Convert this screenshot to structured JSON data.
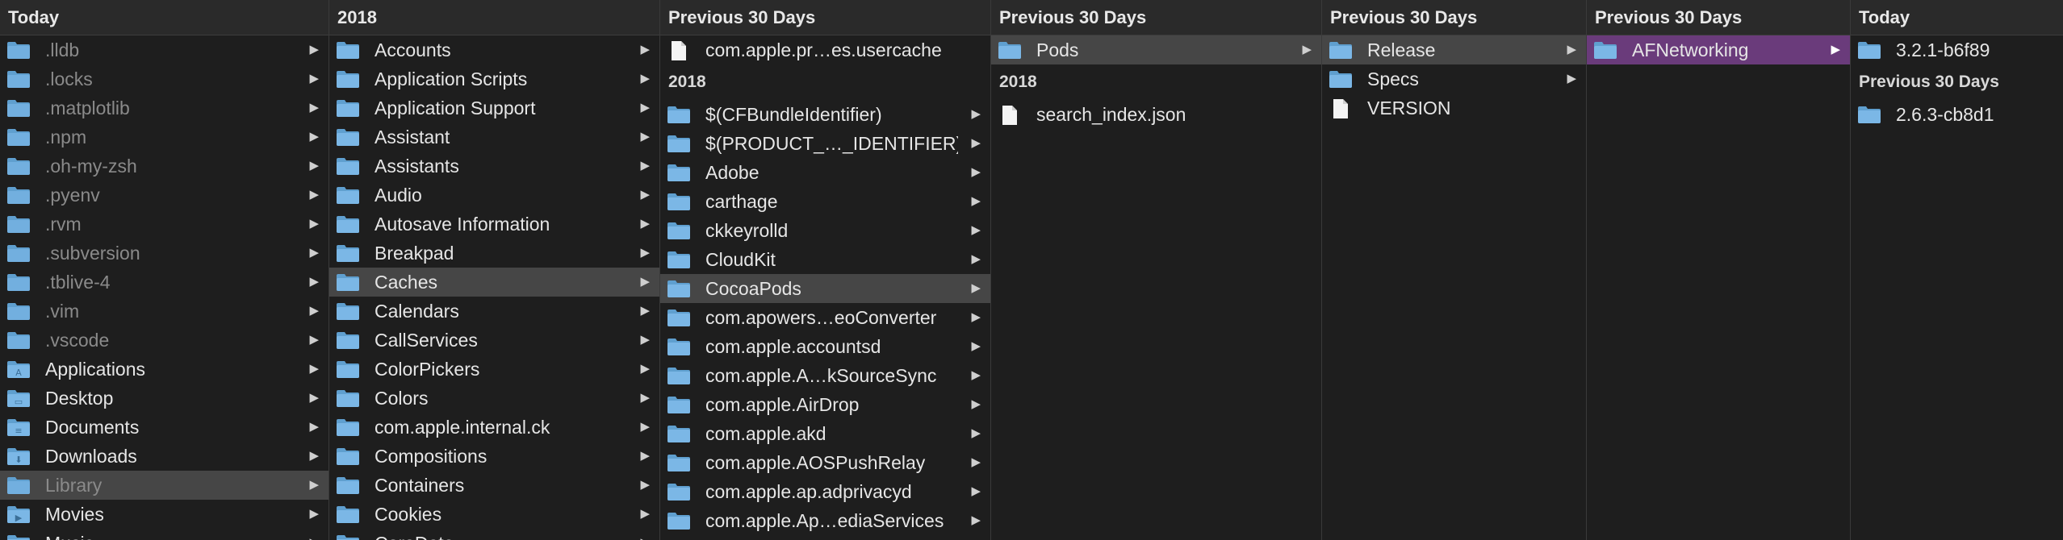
{
  "colors": {
    "background": "#1e1e1e",
    "folder_blue": "#6aaedf",
    "selection_gray": "#464646",
    "selection_purple": "#6a3b7b"
  },
  "columns": [
    {
      "blocks": [
        {
          "header": "Today",
          "items": [
            {
              "label": ".lldb",
              "icon": "folder-icon",
              "dim": true
            },
            {
              "label": ".locks",
              "icon": "folder-icon",
              "dim": true
            },
            {
              "label": ".matplotlib",
              "icon": "folder-icon",
              "dim": true
            },
            {
              "label": ".npm",
              "icon": "folder-icon",
              "dim": true
            },
            {
              "label": ".oh-my-zsh",
              "icon": "folder-icon",
              "dim": true
            },
            {
              "label": ".pyenv",
              "icon": "folder-icon",
              "dim": true
            },
            {
              "label": ".rvm",
              "icon": "folder-icon",
              "dim": true
            },
            {
              "label": ".subversion",
              "icon": "folder-icon",
              "dim": true
            },
            {
              "label": ".tblive-4",
              "icon": "folder-icon",
              "dim": true
            },
            {
              "label": ".vim",
              "icon": "folder-icon",
              "dim": true
            },
            {
              "label": ".vscode",
              "icon": "folder-icon",
              "dim": true
            },
            {
              "label": "Applications",
              "icon": "applications-folder-icon"
            },
            {
              "label": "Desktop",
              "icon": "desktop-folder-icon"
            },
            {
              "label": "Documents",
              "icon": "documents-folder-icon"
            },
            {
              "label": "Downloads",
              "icon": "downloads-folder-icon"
            },
            {
              "label": "Library",
              "icon": "folder-icon",
              "dim": true,
              "selected": "gray"
            },
            {
              "label": "Movies",
              "icon": "movies-folder-icon"
            },
            {
              "label": "Music",
              "icon": "music-folder-icon"
            }
          ]
        }
      ]
    },
    {
      "blocks": [
        {
          "header": "2018",
          "items": [
            {
              "label": "Accounts",
              "icon": "folder-icon"
            },
            {
              "label": "Application Scripts",
              "icon": "folder-icon"
            },
            {
              "label": "Application Support",
              "icon": "folder-icon"
            },
            {
              "label": "Assistant",
              "icon": "folder-icon"
            },
            {
              "label": "Assistants",
              "icon": "folder-icon"
            },
            {
              "label": "Audio",
              "icon": "folder-icon"
            },
            {
              "label": "Autosave Information",
              "icon": "folder-icon"
            },
            {
              "label": "Breakpad",
              "icon": "folder-icon"
            },
            {
              "label": "Caches",
              "icon": "folder-icon",
              "selected": "gray"
            },
            {
              "label": "Calendars",
              "icon": "folder-icon"
            },
            {
              "label": "CallServices",
              "icon": "folder-icon"
            },
            {
              "label": "ColorPickers",
              "icon": "folder-icon"
            },
            {
              "label": "Colors",
              "icon": "folder-icon"
            },
            {
              "label": "com.apple.internal.ck",
              "icon": "folder-icon"
            },
            {
              "label": "Compositions",
              "icon": "folder-icon"
            },
            {
              "label": "Containers",
              "icon": "folder-icon"
            },
            {
              "label": "Cookies",
              "icon": "folder-icon"
            },
            {
              "label": "CoreData",
              "icon": "folder-icon"
            }
          ]
        }
      ]
    },
    {
      "blocks": [
        {
          "header": "Previous 30 Days",
          "items": [
            {
              "label": "com.apple.pr…es.usercache",
              "icon": "file-icon",
              "nochev": true
            }
          ]
        },
        {
          "section": "2018",
          "items": [
            {
              "label": "$(CFBundleIdentifier)",
              "icon": "folder-icon"
            },
            {
              "label": "$(PRODUCT_…_IDENTIFIER)",
              "icon": "folder-icon"
            },
            {
              "label": "Adobe",
              "icon": "folder-icon"
            },
            {
              "label": "carthage",
              "icon": "folder-icon"
            },
            {
              "label": "ckkeyrolld",
              "icon": "folder-icon"
            },
            {
              "label": "CloudKit",
              "icon": "folder-icon"
            },
            {
              "label": "CocoaPods",
              "icon": "folder-icon",
              "selected": "gray"
            },
            {
              "label": "com.apowers…eoConverter",
              "icon": "folder-icon"
            },
            {
              "label": "com.apple.accountsd",
              "icon": "folder-icon"
            },
            {
              "label": "com.apple.A…kSourceSync",
              "icon": "folder-icon"
            },
            {
              "label": "com.apple.AirDrop",
              "icon": "folder-icon"
            },
            {
              "label": "com.apple.akd",
              "icon": "folder-icon"
            },
            {
              "label": "com.apple.AOSPushRelay",
              "icon": "folder-icon"
            },
            {
              "label": "com.apple.ap.adprivacyd",
              "icon": "folder-icon"
            },
            {
              "label": "com.apple.Ap…ediaServices",
              "icon": "folder-icon"
            }
          ]
        }
      ]
    },
    {
      "blocks": [
        {
          "header": "Previous 30 Days",
          "items": [
            {
              "label": "Pods",
              "icon": "folder-icon",
              "selected": "gray"
            }
          ]
        },
        {
          "section": "2018",
          "items": [
            {
              "label": "search_index.json",
              "icon": "file-icon",
              "nochev": true
            }
          ]
        }
      ]
    },
    {
      "blocks": [
        {
          "header": "Previous 30 Days",
          "items": [
            {
              "label": "Release",
              "icon": "folder-icon",
              "selected": "gray"
            },
            {
              "label": "Specs",
              "icon": "folder-icon"
            },
            {
              "label": "VERSION",
              "icon": "file-icon",
              "nochev": true
            }
          ]
        }
      ]
    },
    {
      "blocks": [
        {
          "header": "Previous 30 Days",
          "items": [
            {
              "label": "AFNetworking",
              "icon": "folder-icon",
              "selected": "purple"
            }
          ]
        }
      ]
    },
    {
      "blocks": [
        {
          "header": "Today",
          "items": [
            {
              "label": "3.2.1-b6f89",
              "icon": "folder-icon",
              "nochev": true
            }
          ]
        },
        {
          "section": "Previous 30 Days",
          "items": [
            {
              "label": "2.6.3-cb8d1",
              "icon": "folder-icon",
              "nochev": true
            }
          ]
        }
      ]
    }
  ]
}
